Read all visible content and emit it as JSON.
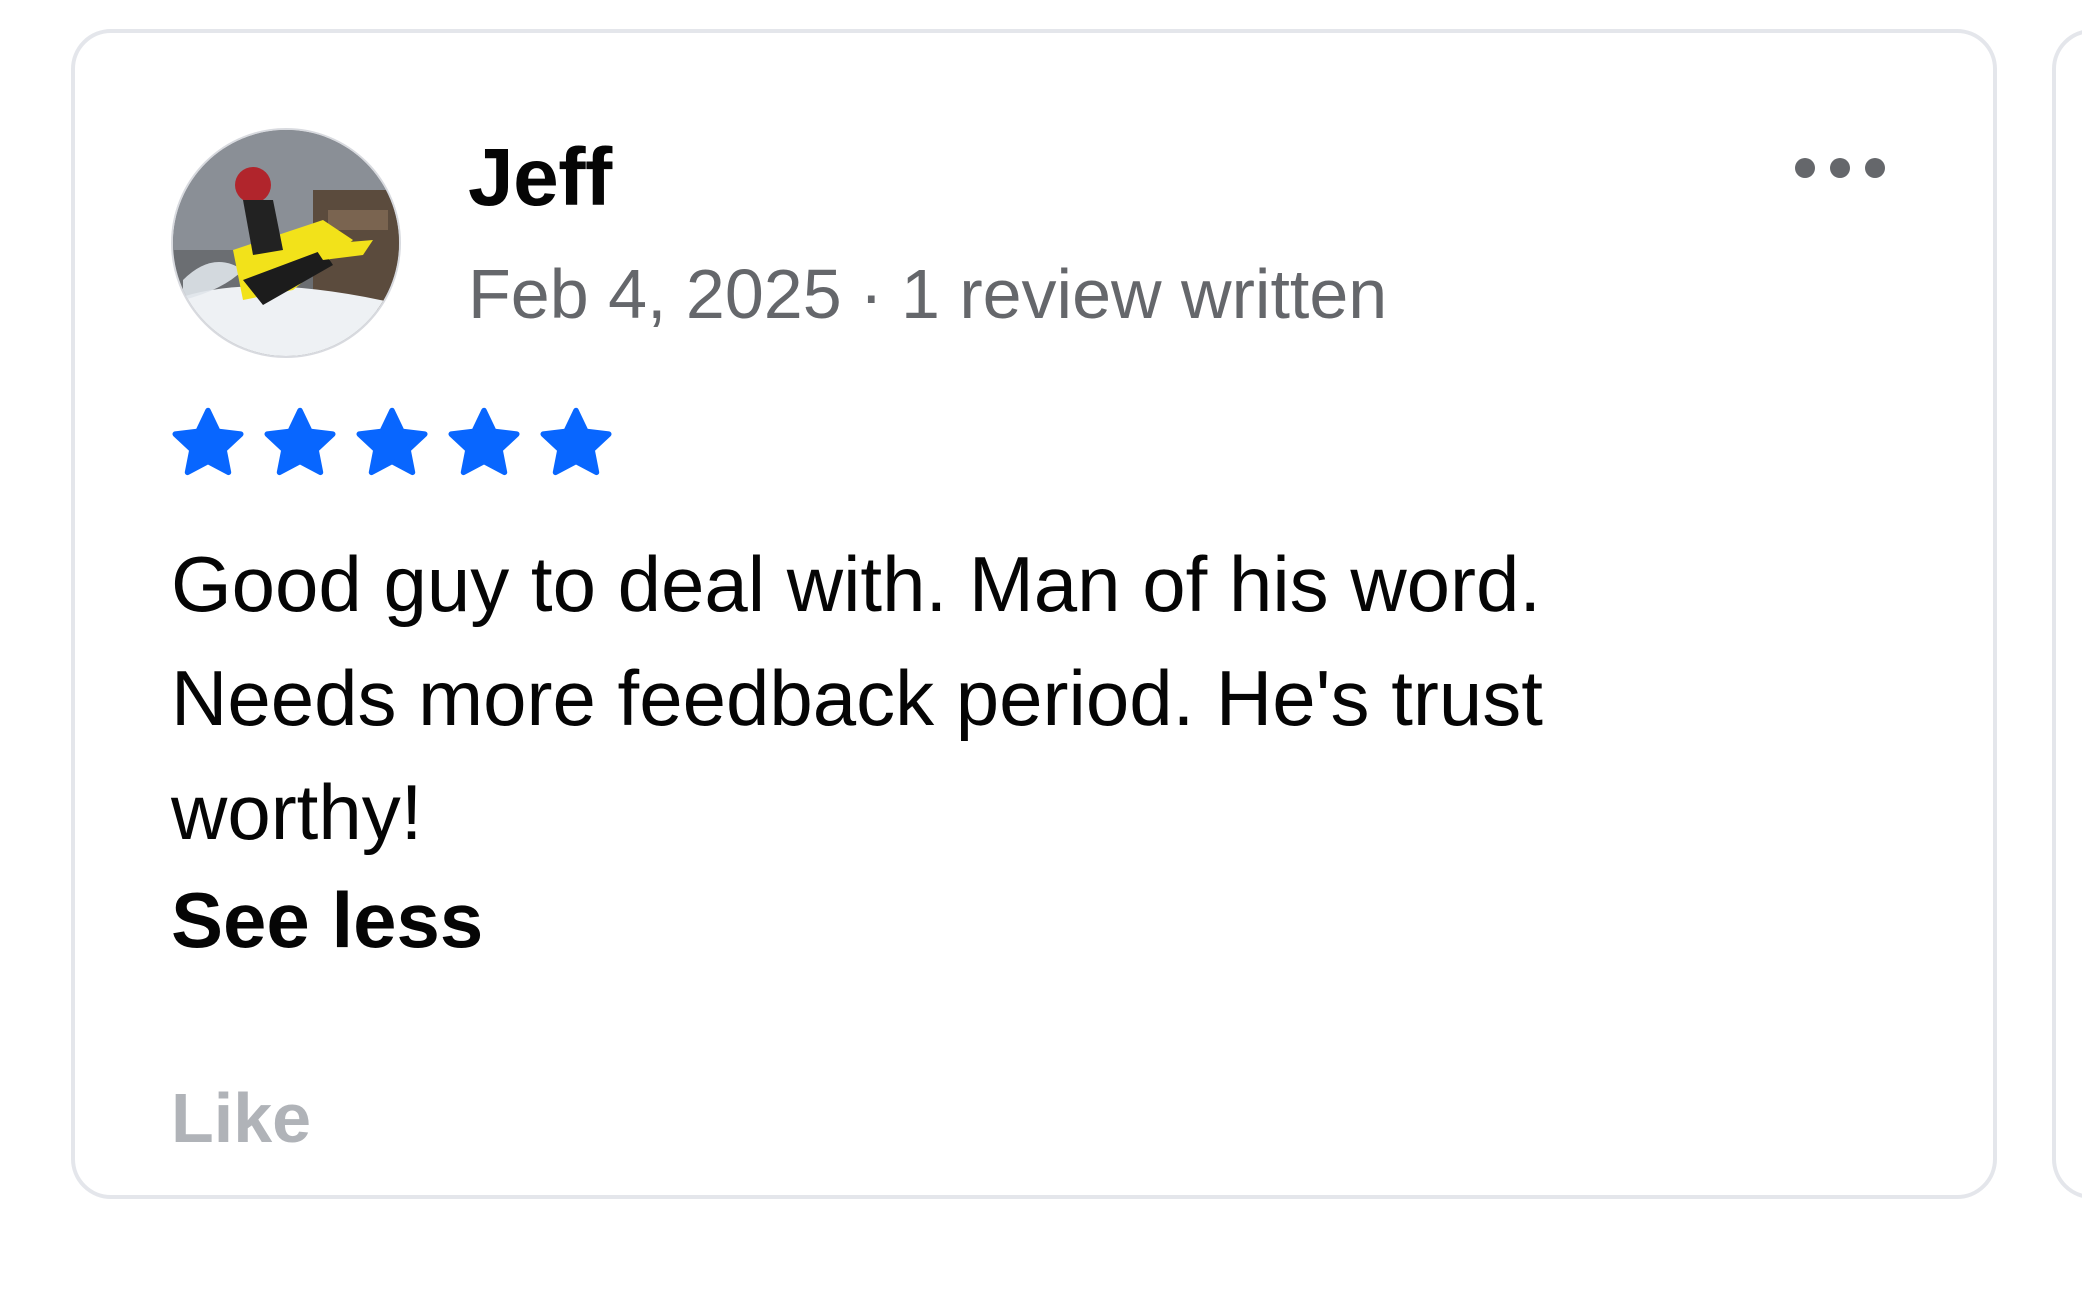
{
  "review": {
    "avatar_icon": "snowmobile-photo",
    "reviewer_name": "Jeff",
    "date": "Feb 4, 2025",
    "separator": "·",
    "reviews_written": "1 review written",
    "more_icon": "more-horizontal-icon",
    "rating": 5,
    "rating_max": 5,
    "star_color": "#0866ff",
    "text": "Good guy to deal with.  Man of his word.\nNeeds more feedback period. He's trust\nworthy!",
    "see_less_label": "See less",
    "like_label": "Like"
  }
}
